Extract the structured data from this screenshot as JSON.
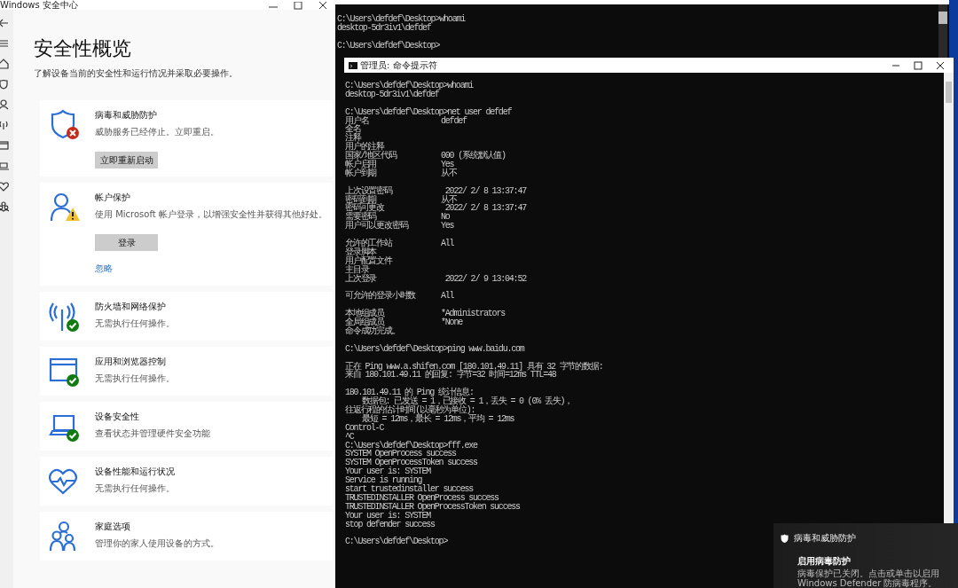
{
  "security_window": {
    "title": "Windows 安全中心",
    "heading": "安全性概览",
    "subtitle": "了解设备当前的安全性和运行情况并采取必要操作。",
    "cards": [
      {
        "kind": "error",
        "title": "病毒和威胁防护",
        "description": "威胁服务已经停止。立即重启。",
        "button": "立即重新启动"
      },
      {
        "kind": "warning",
        "title": "帐户保护",
        "description": "使用 Microsoft 帐户登录，以增强安全性并获得其他好处。",
        "button": "登录",
        "link": "忽略"
      },
      {
        "kind": "ok",
        "title": "防火墙和网络保护",
        "description": "无需执行任何操作。"
      },
      {
        "kind": "ok",
        "title": "应用和浏览器控制",
        "description": "无需执行任何操作。"
      },
      {
        "kind": "ok",
        "title": "设备安全性",
        "description": "查看状态并管理硬件安全功能"
      },
      {
        "kind": "plain",
        "title": "设备性能和运行状况",
        "description": "无需执行任何操作。"
      },
      {
        "kind": "plain",
        "title": "家庭选项",
        "description": "管理你的家人使用设备的方式。"
      }
    ]
  },
  "back_terminal": {
    "groups": [
      {
        "lines": [
          {
            "kind": "text",
            "text": "C:\\Users\\defdef\\Desktop>whoami"
          },
          {
            "kind": "text",
            "text": "desktop-5dr3iv1\\defdef"
          }
        ]
      },
      {
        "lines": [
          {
            "kind": "text",
            "text": "C:\\Users\\defdef\\Desktop>"
          }
        ]
      }
    ]
  },
  "front_terminal": {
    "title": "管理员: 命令提示符",
    "groups": [
      {
        "lines": [
          {
            "kind": "text",
            "text": "C:\\Users\\defdef\\Desktop>whoami"
          },
          {
            "kind": "text",
            "text": "desktop-5dr3iv1\\defdef"
          }
        ]
      },
      {
        "lines": [
          {
            "kind": "text",
            "text": "C:\\Users\\defdef\\Desktop>net user defdef"
          },
          {
            "kind": "field",
            "label": "用户名",
            "value": "defdef"
          },
          {
            "kind": "text",
            "text": "全名"
          },
          {
            "kind": "text",
            "text": "注释"
          },
          {
            "kind": "text",
            "text": "用户的注释"
          },
          {
            "kind": "field",
            "label": "国家/地区代码",
            "value": "000 (系统默认值)"
          },
          {
            "kind": "field",
            "label": "帐户启用",
            "value": "Yes"
          },
          {
            "kind": "field",
            "label": "帐户到期",
            "value": "从不"
          }
        ]
      },
      {
        "lines": [
          {
            "kind": "field",
            "label": "上次设置密码",
            "value": " 2022/ 2/ 8 13:37:47"
          },
          {
            "kind": "field",
            "label": "密码到期",
            "value": "从不"
          },
          {
            "kind": "field",
            "label": "密码可更改",
            "value": " 2022/ 2/ 8 13:37:47"
          },
          {
            "kind": "field",
            "label": "需要密码",
            "value": "No"
          },
          {
            "kind": "field",
            "label": "用户可以更改密码",
            "value": "Yes"
          }
        ]
      },
      {
        "lines": [
          {
            "kind": "field",
            "label": "允许的工作站",
            "value": "All"
          },
          {
            "kind": "text",
            "text": "登录脚本"
          },
          {
            "kind": "text",
            "text": "用户配置文件"
          },
          {
            "kind": "text",
            "text": "主目录"
          },
          {
            "kind": "field",
            "label": "上次登录",
            "value": " 2022/ 2/ 9 13:04:52"
          }
        ]
      },
      {
        "lines": [
          {
            "kind": "field",
            "label": "可允许的登录小时数",
            "value": "All"
          }
        ]
      },
      {
        "lines": [
          {
            "kind": "field",
            "label": "本地组成员",
            "value": "*Administrators"
          },
          {
            "kind": "field",
            "label": "全局组成员",
            "value": "*None"
          },
          {
            "kind": "text",
            "text": "命令成功完成。"
          }
        ]
      },
      {
        "lines": [
          {
            "kind": "text",
            "text": "C:\\Users\\defdef\\Desktop>ping www.baidu.com"
          }
        ]
      },
      {
        "lines": [
          {
            "kind": "text",
            "text": "正在 Ping www.a.shifen.com [180.101.49.11] 具有 32 字节的数据:"
          },
          {
            "kind": "text",
            "text": "来自 180.101.49.11 的回复: 字节=32 时间=12ms TTL=48"
          }
        ]
      },
      {
        "lines": [
          {
            "kind": "text",
            "text": "180.101.49.11 的 Ping 统计信息:"
          },
          {
            "kind": "text",
            "text": "    数据包: 已发送 = 1，已接收 = 1，丢失 = 0 (0% 丢失)，"
          },
          {
            "kind": "text",
            "text": "往返行程的估计时间(以毫秒为单位):"
          },
          {
            "kind": "text",
            "text": "    最短 = 12ms，最长 = 12ms，平均 = 12ms"
          },
          {
            "kind": "text",
            "text": "Control-C"
          },
          {
            "kind": "text",
            "text": "^C"
          },
          {
            "kind": "text",
            "text": "C:\\Users\\defdef\\Desktop>fff.exe"
          },
          {
            "kind": "text",
            "text": "SYSTEM OpenProcess success"
          },
          {
            "kind": "text",
            "text": "SYSTEM OpenProcessToken success"
          },
          {
            "kind": "text",
            "text": "Your user is: SYSTEM"
          },
          {
            "kind": "text",
            "text": "Service is running"
          },
          {
            "kind": "text",
            "text": "start trustedinstaller success"
          },
          {
            "kind": "text",
            "text": "TRUSTEDINSTALLER OpenProcess success"
          },
          {
            "kind": "text",
            "text": "TRUSTEDINSTALLER OpenProcessToken success"
          },
          {
            "kind": "text",
            "text": "Your user is: SYSTEM"
          },
          {
            "kind": "text",
            "text": "stop defender success"
          }
        ]
      },
      {
        "lines": [
          {
            "kind": "text",
            "text": "C:\\Users\\defdef\\Desktop>"
          }
        ]
      }
    ]
  },
  "toast": {
    "title": "病毒和威胁防护",
    "heading": "启用病毒防护",
    "body": "病毒保护已关闭。点击或单击以启用 Windows Defender 防病毒程序。"
  }
}
